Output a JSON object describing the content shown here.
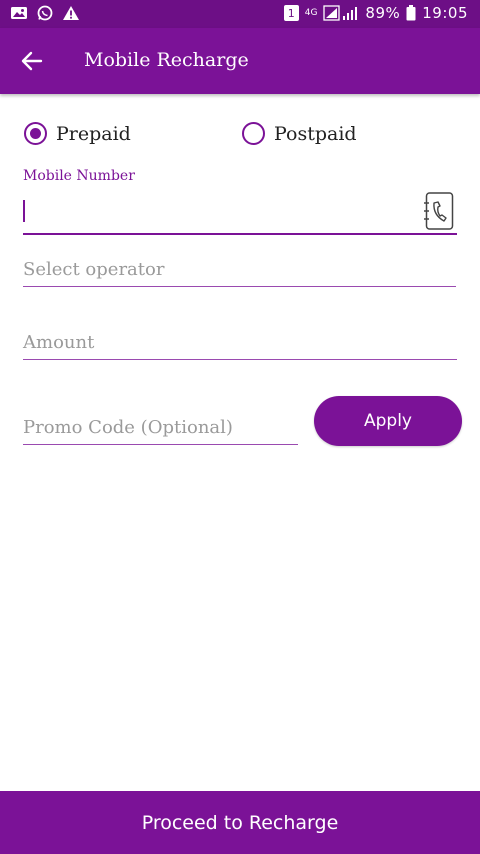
{
  "status_bar": {
    "left_icons": [
      "image-icon",
      "whatsapp-icon",
      "warning-icon"
    ],
    "sim_badge": "1",
    "network": "4G",
    "battery": "89%",
    "time": "19:05"
  },
  "app_bar": {
    "title": "Mobile Recharge",
    "back_icon": "arrow-left-icon"
  },
  "plan_type": {
    "options": [
      {
        "label": "Prepaid",
        "selected": true
      },
      {
        "label": "Postpaid",
        "selected": false
      }
    ]
  },
  "form": {
    "mobile_number": {
      "label": "Mobile Number",
      "value": "",
      "icon": "contact-book-icon"
    },
    "operator": {
      "placeholder": "Select operator",
      "value": ""
    },
    "amount": {
      "placeholder": "Amount",
      "value": ""
    },
    "promo_code": {
      "placeholder": "Promo Code (Optional)",
      "value": ""
    },
    "apply_label": "Apply"
  },
  "footer": {
    "proceed_label": "Proceed to Recharge"
  },
  "colors": {
    "primary": "#7b1297",
    "status_bar": "#6d0f86",
    "placeholder": "#9a9a9a"
  }
}
